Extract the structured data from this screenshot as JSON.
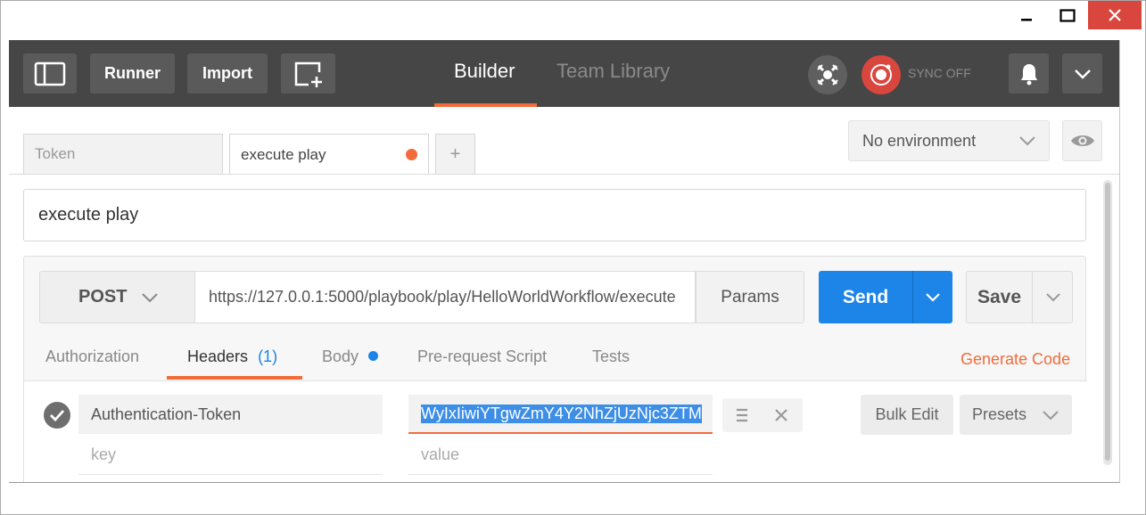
{
  "window": {
    "controls": {
      "minimize": "minimize-icon",
      "maximize": "maximize-icon",
      "close": "close-icon"
    }
  },
  "header": {
    "sidebar_toggle_icon": "sidebar-icon",
    "runner_label": "Runner",
    "import_label": "Import",
    "new_window_icon": "new-window-icon",
    "tabs": [
      {
        "label": "Builder",
        "active": true
      },
      {
        "label": "Team Library",
        "active": false
      }
    ],
    "interceptor_icon": "satellite-icon",
    "sync_icon": "sync-icon",
    "sync_label": "SYNC OFF",
    "notifications_icon": "bell-icon",
    "menu_icon": "chevron-down-icon"
  },
  "request_tabs": [
    {
      "label": "Token",
      "active": false
    },
    {
      "label": "execute play",
      "active": true,
      "unsaved": true
    }
  ],
  "add_tab_label": "+",
  "environment": {
    "selected": "No environment",
    "quick_look_icon": "eye-icon"
  },
  "request": {
    "name": "execute play",
    "method": "POST",
    "url": "https://127.0.0.1:5000/playbook/play/HelloWorldWorkflow/execute",
    "params_label": "Params",
    "send_label": "Send",
    "save_label": "Save"
  },
  "subtabs": [
    {
      "label": "Authorization"
    },
    {
      "label": "Headers",
      "count": "(1)"
    },
    {
      "label": "Body"
    },
    {
      "label": "Pre-request Script"
    },
    {
      "label": "Tests"
    }
  ],
  "generate_code_label": "Generate Code",
  "headers": {
    "rows": [
      {
        "key": "Authentication-Token",
        "value": "WyIxIiwiYTgwZmY4Y2NhZjUzNjc3ZTM"
      }
    ],
    "key_placeholder": "key",
    "value_placeholder": "value",
    "bulk_edit_label": "Bulk Edit",
    "presets_label": "Presets"
  },
  "colors": {
    "header_bg": "#464646",
    "accent": "#f26b3a",
    "send_blue": "#1d84e8",
    "selection_blue": "#3d8ee6",
    "headers_count": "#1d84e8",
    "body_dot": "#1d84e8",
    "unsaved_dot": "#f26b3a",
    "sync_red": "#d9463d"
  }
}
